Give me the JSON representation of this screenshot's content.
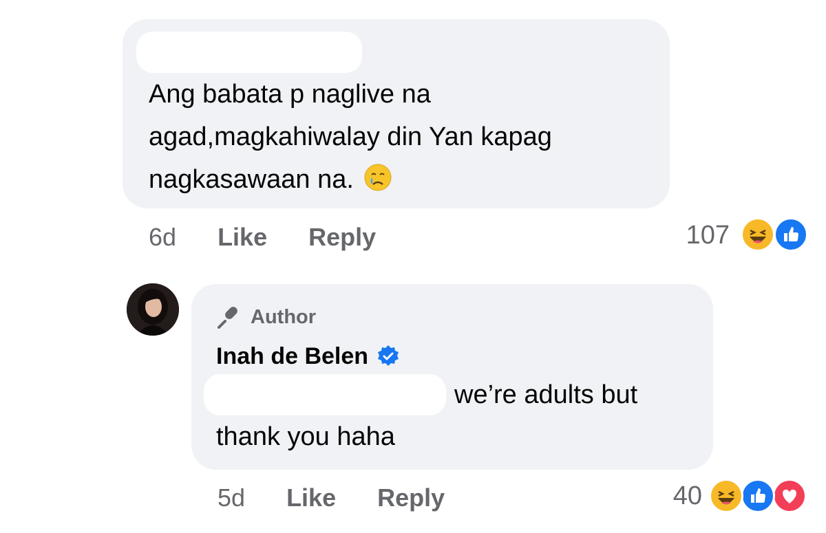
{
  "comment1": {
    "text_lines": [
      "Ang babata p naglive na",
      "agad,magkahiwalay din Yan kapag",
      "nagkasawaan na."
    ],
    "emoji": "crying-face",
    "time": "6d",
    "like_label": "Like",
    "reply_label": "Reply",
    "reaction_count": "107",
    "reactions": [
      "haha",
      "like"
    ]
  },
  "reply1": {
    "author_label": "Author",
    "name": "Inah de Belen",
    "verified": true,
    "text_line1": "we’re adults but",
    "text_line2": "thank you haha",
    "time": "5d",
    "like_label": "Like",
    "reply_label": "Reply",
    "reaction_count": "40",
    "reactions": [
      "haha",
      "like",
      "love"
    ]
  },
  "colors": {
    "bubble": "#f0f2f5",
    "meta_text": "#65676b",
    "like_blue": "#1877f2",
    "love_red": "#f33e58",
    "haha_yellow": "#f7b928",
    "verified_blue": "#1877f2"
  }
}
